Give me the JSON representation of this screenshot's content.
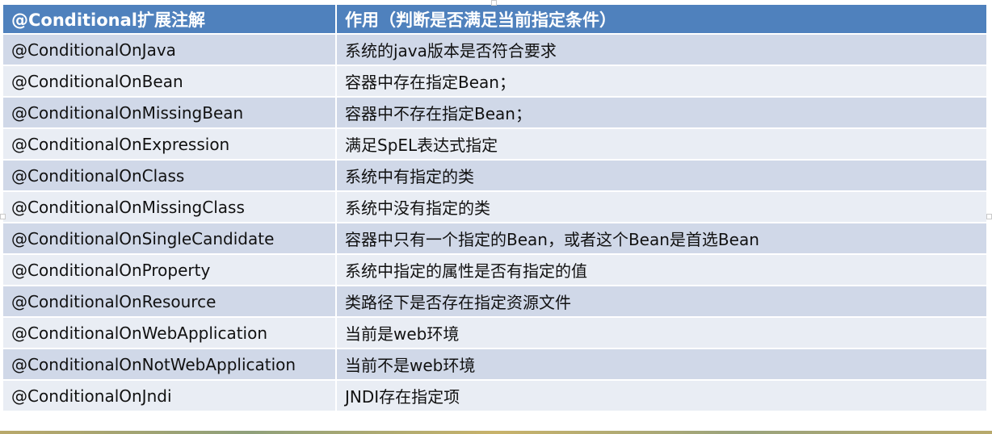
{
  "table": {
    "headers": [
      "@Conditional扩展注解",
      "作用（判断是否满足当前指定条件）"
    ],
    "rows": [
      [
        "@ConditionalOnJava",
        "系统的java版本是否符合要求"
      ],
      [
        "@ConditionalOnBean",
        "容器中存在指定Bean；"
      ],
      [
        "@ConditionalOnMissingBean",
        "容器中不存在指定Bean；"
      ],
      [
        "@ConditionalOnExpression",
        "满足SpEL表达式指定"
      ],
      [
        "@ConditionalOnClass",
        "系统中有指定的类"
      ],
      [
        "@ConditionalOnMissingClass",
        "系统中没有指定的类"
      ],
      [
        "@ConditionalOnSingleCandidate",
        "容器中只有一个指定的Bean，或者这个Bean是首选Bean"
      ],
      [
        "@ConditionalOnProperty",
        "系统中指定的属性是否有指定的值"
      ],
      [
        "@ConditionalOnResource",
        "类路径下是否存在指定资源文件"
      ],
      [
        "@ConditionalOnWebApplication",
        "当前是web环境"
      ],
      [
        "@ConditionalOnNotWebApplication",
        "当前不是web环境"
      ],
      [
        "@ConditionalOnJndi",
        "JNDI存在指定项"
      ]
    ]
  },
  "colors": {
    "header_bg": "#4f81bd",
    "row_odd_bg": "#d0d8e8",
    "row_even_bg": "#e9edf4"
  }
}
